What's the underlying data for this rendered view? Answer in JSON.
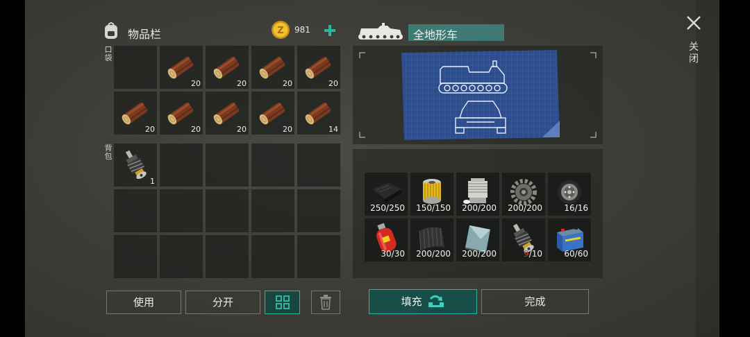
{
  "inventory": {
    "title": "物品栏",
    "coins": "981",
    "pocket_label": "口袋",
    "backpack_label": "背包",
    "pocket_slots": [
      {
        "item": "",
        "count": ""
      },
      {
        "item": "log",
        "count": "20"
      },
      {
        "item": "log",
        "count": "20"
      },
      {
        "item": "log",
        "count": "20"
      },
      {
        "item": "log",
        "count": "20"
      },
      {
        "item": "log",
        "count": "20"
      },
      {
        "item": "log",
        "count": "20"
      },
      {
        "item": "log",
        "count": "20"
      },
      {
        "item": "log",
        "count": "20"
      },
      {
        "item": "log",
        "count": "14"
      }
    ],
    "backpack_slots": [
      {
        "item": "shock-absorber",
        "count": "1"
      }
    ]
  },
  "buttons": {
    "use": "使用",
    "split": "分开",
    "fill": "填充",
    "done": "完成",
    "close": "关闭"
  },
  "vehicle": {
    "name": "全地形车",
    "requirements": [
      {
        "item": "rubber-sheet",
        "have": "250",
        "need": "250"
      },
      {
        "item": "oil-filter",
        "have": "150",
        "need": "150"
      },
      {
        "item": "engine-block",
        "have": "200",
        "need": "200"
      },
      {
        "item": "gear",
        "have": "200",
        "need": "200"
      },
      {
        "item": "wheel-rim",
        "have": "16",
        "need": "16"
      },
      {
        "item": "gas-cylinder",
        "have": "30",
        "need": "30"
      },
      {
        "item": "carbon-sheet",
        "have": "200",
        "need": "200"
      },
      {
        "item": "metal-plate",
        "have": "200",
        "need": "200"
      },
      {
        "item": "shock-absorber",
        "have": "9",
        "need": "10"
      },
      {
        "item": "battery",
        "have": "60",
        "need": "60"
      }
    ]
  },
  "colors": {
    "accent": "#2fb3a3",
    "coin": "#e7b320",
    "missing": "#e03a2c"
  }
}
